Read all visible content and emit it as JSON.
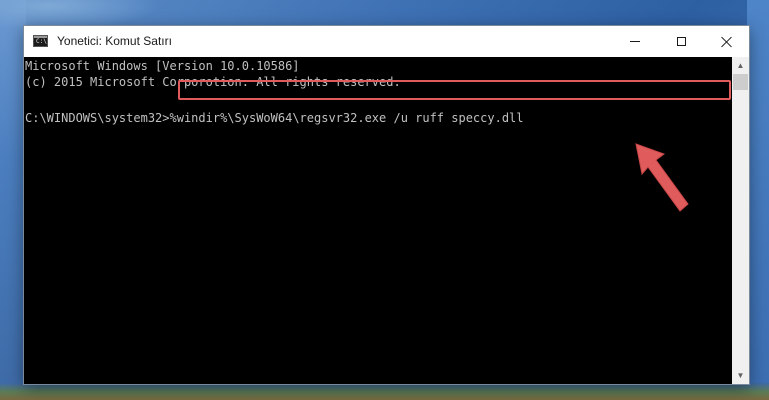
{
  "window": {
    "title": "Yonetici: Komut Satırı",
    "controls": {
      "minimize": "minimize-icon",
      "maximize": "maximize-icon",
      "close": "close-icon"
    }
  },
  "console": {
    "lines": [
      "Microsoft Windows [Version 10.0.10586]",
      "(c) 2015 Microsoft Corporotion. All rights reserved."
    ],
    "prompt": "C:\\WINDOWS\\system32>",
    "command": "%windir%\\SysWoW64\\regsvr32.exe /u ruff speccy.dll"
  },
  "annotation": {
    "highlight_color": "#e05c5c",
    "arrow_color": "#e05c5c",
    "arrow_icon": "pointer-arrow-icon"
  },
  "colors": {
    "console_text": "#c0c0c0",
    "console_bg": "#000000",
    "titlebar_bg": "#ffffff"
  }
}
